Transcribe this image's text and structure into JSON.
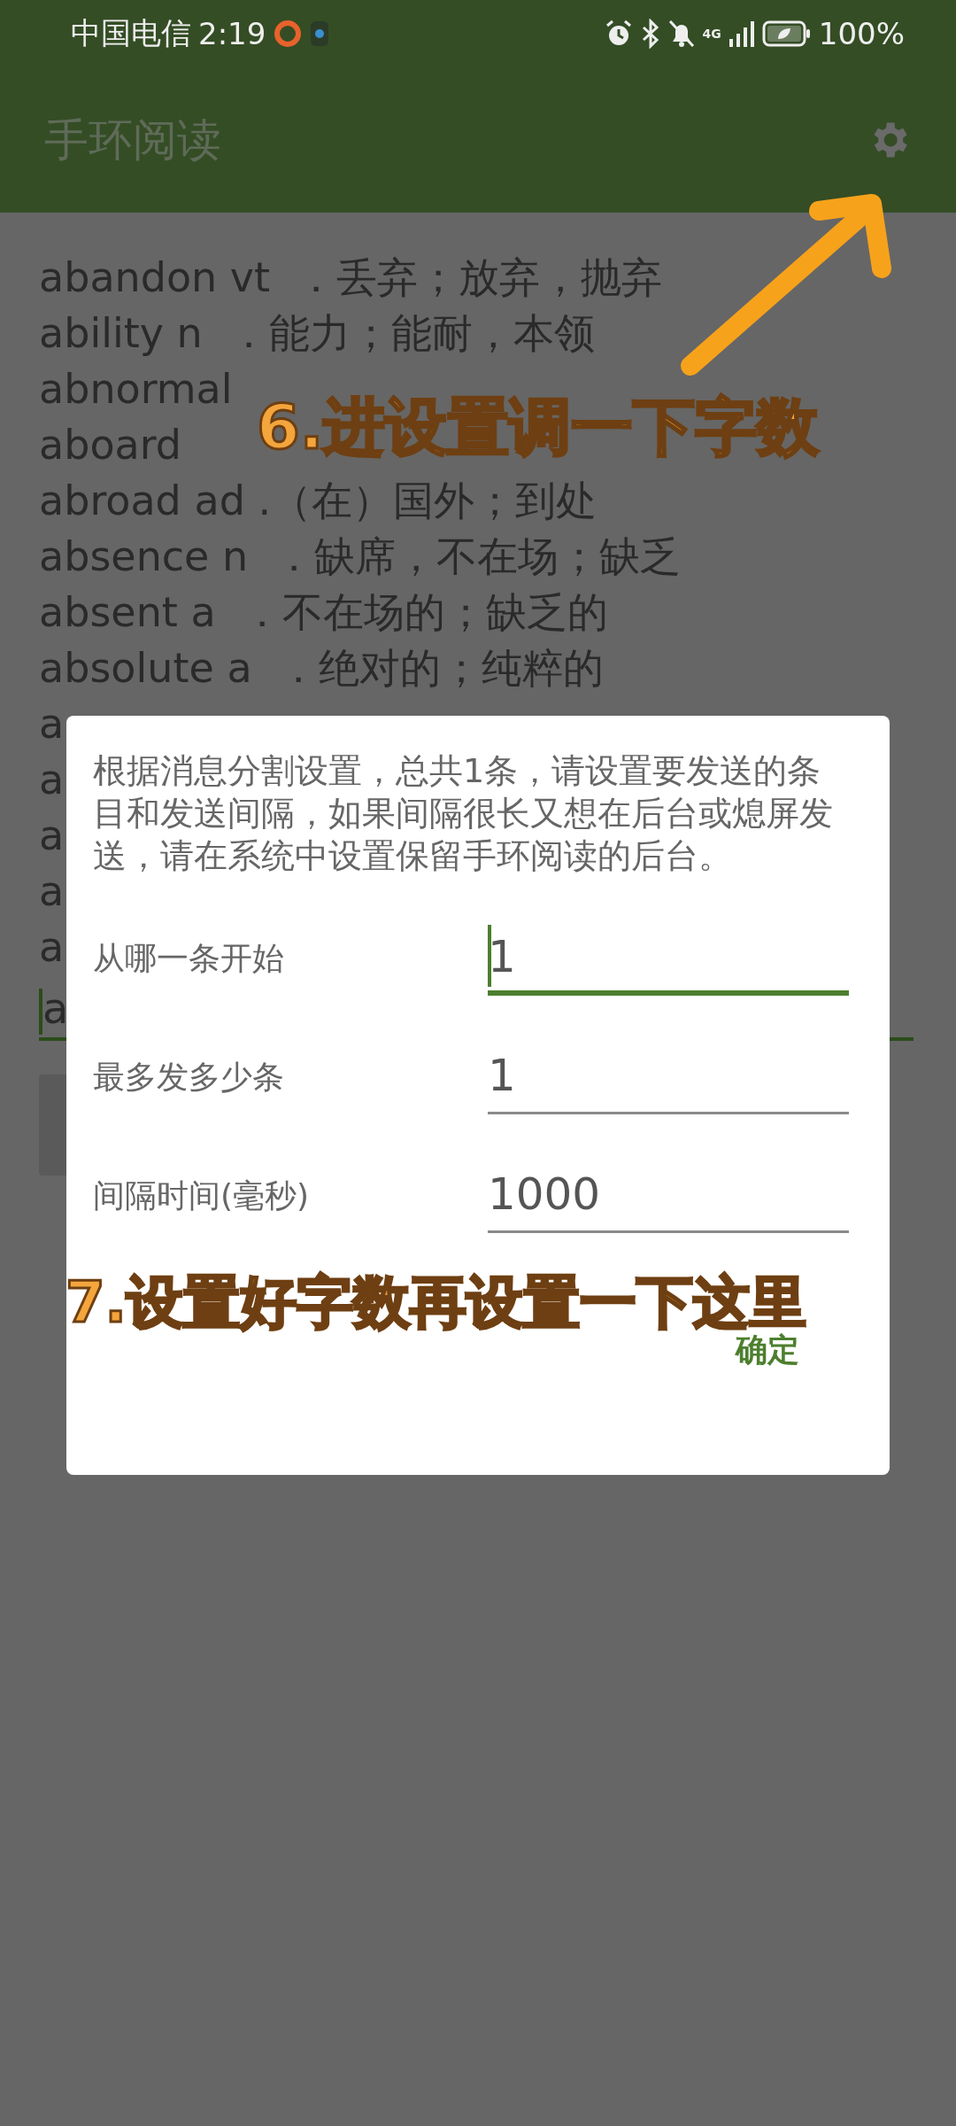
{
  "status_bar": {
    "carrier": "中国电信",
    "time": "2:19",
    "network": "4G",
    "battery": "100%"
  },
  "app_bar": {
    "title": "手环阅读"
  },
  "word_list": [
    "abandon vt  ．丢弃；放弃，抛弃",
    "ability n  ．能力；能耐，本领",
    "abnormal",
    "aboard",
    "abroad ad .（在）国外；到处",
    "absence n  ．缺席，不在场；缺乏",
    "absent a  ．不在场的；缺乏的",
    "absolute a  ．绝对的；纯粹的",
    "a",
    "a",
    "a",
    "a",
    "a"
  ],
  "editor": {
    "value": "a",
    "focused": true
  },
  "dialog": {
    "message": "根据消息分割设置，总共1条，请设置要发送的条目和发送间隔，如果间隔很长又想在后台或熄屏发送，请在系统中设置保留手环阅读的后台。",
    "fields": [
      {
        "label": "从哪一条开始",
        "value": "1",
        "focused": true
      },
      {
        "label": "最多发多少条",
        "value": "1",
        "focused": false
      },
      {
        "label": "间隔时间(毫秒)",
        "value": "1000",
        "focused": false
      }
    ],
    "confirm": "确定"
  },
  "annotations": [
    {
      "kind": "settings",
      "text": "6.进设置调一下字数"
    },
    {
      "kind": "fields",
      "text": "7.设置好字数再设置一下这里"
    }
  ]
}
